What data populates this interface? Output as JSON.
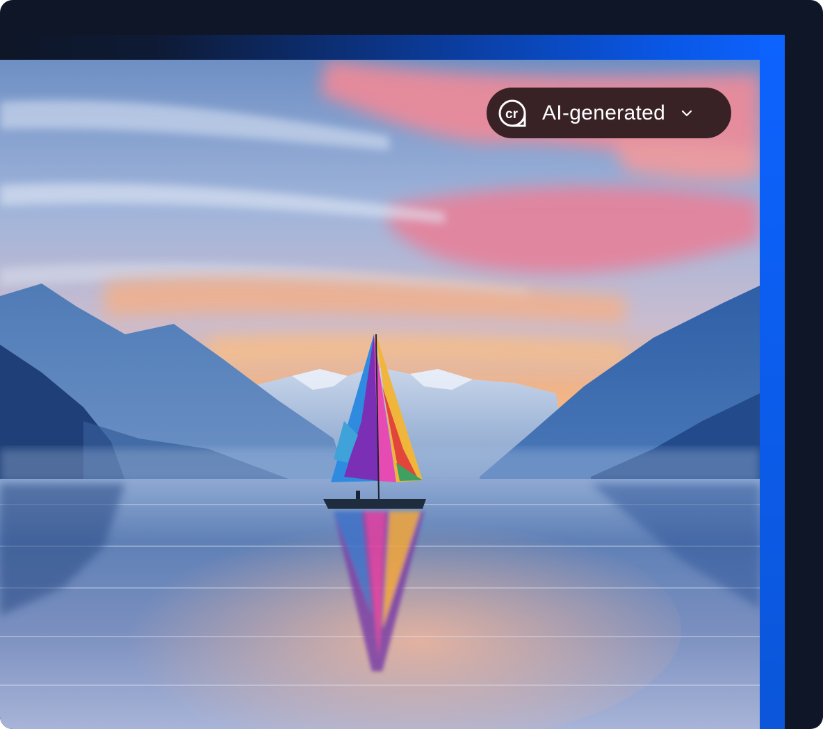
{
  "credential_badge": {
    "label": "AI-generated",
    "icon": "content-credentials-cr-icon",
    "expand_icon": "chevron-down-icon"
  },
  "image": {
    "subject": "sailboat-on-mountain-lake-at-sunset"
  },
  "colors": {
    "frame": "#0e1627",
    "accent_blue": "#0d63ff",
    "badge_bg": "#261618",
    "badge_text": "#ffffff"
  }
}
